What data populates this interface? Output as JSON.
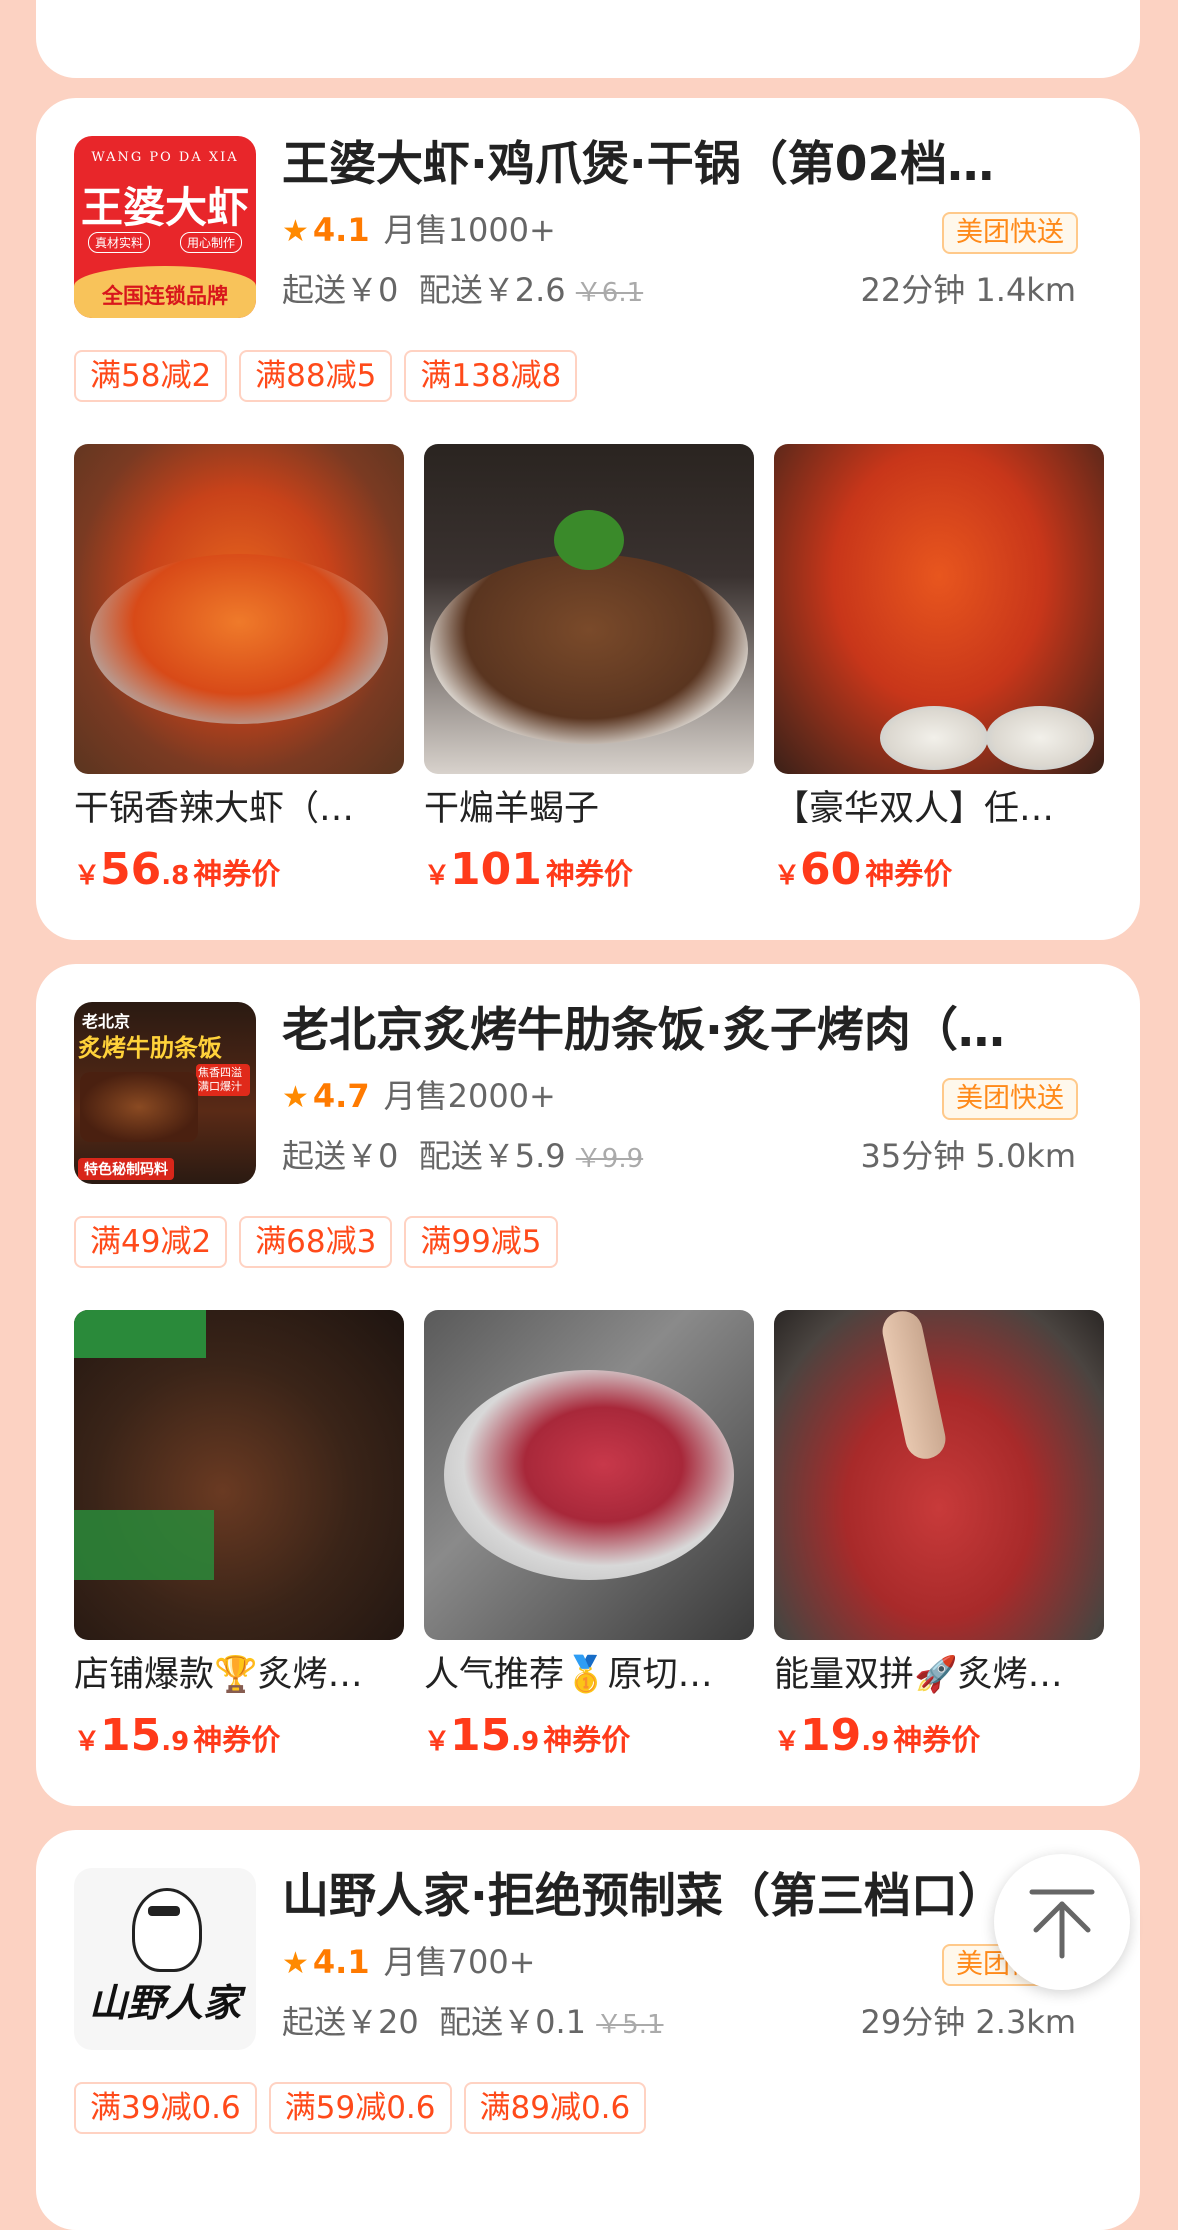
{
  "colors": {
    "accent": "#ff3a1a",
    "rating": "#ff7a00",
    "background": "#fcd2c2",
    "badge": "#ff8a1a"
  },
  "stores": [
    {
      "name": "王婆大虾·鸡爪煲·干锅（第02档…",
      "logo": {
        "top_text": "WANG PO DA XIA",
        "main_text": "王婆大虾",
        "sub_text": [
          "真材实料",
          "用心制作"
        ],
        "bottom_text": "全国连锁品牌"
      },
      "rating": "4.1",
      "monthly_sales": "月售1000+",
      "badge": "美团快送",
      "min_order": "起送￥0",
      "delivery_fee": "配送￥2.6",
      "original_fee": "￥6.1",
      "time": "22分钟",
      "distance": "1.4km",
      "coupons": [
        "满58减2",
        "满88减5",
        "满138减8"
      ],
      "dishes": [
        {
          "name": "干锅香辣大虾（…",
          "yen": "￥",
          "price_int": "56",
          "price_dec": ".8",
          "tag": "神券价"
        },
        {
          "name": "干煸羊蝎子",
          "yen": "￥",
          "price_int": "101",
          "price_dec": "",
          "tag": "神券价"
        },
        {
          "name": "【豪华双人】任…",
          "yen": "￥",
          "price_int": "60",
          "price_dec": "",
          "tag": "神券价"
        }
      ]
    },
    {
      "name": "老北京炙烤牛肋条饭·炙子烤肉（…",
      "logo": {
        "top_text": "老北京",
        "main_text": "炙烤牛肋条饭",
        "sub_text": [
          "焦香四溢",
          "满口爆汁"
        ],
        "bottom_text": "特色秘制码料"
      },
      "rating": "4.7",
      "monthly_sales": "月售2000+",
      "badge": "美团快送",
      "min_order": "起送￥0",
      "delivery_fee": "配送￥5.9",
      "original_fee": "￥9.9",
      "time": "35分钟",
      "distance": "5.0km",
      "coupons": [
        "满49减2",
        "满68减3",
        "满99减5"
      ],
      "dishes": [
        {
          "name": "店铺爆款🏆炙烤…",
          "yen": "￥",
          "price_int": "15",
          "price_dec": ".9",
          "tag": "神券价"
        },
        {
          "name": "人气推荐🥇原切…",
          "yen": "￥",
          "price_int": "15",
          "price_dec": ".9",
          "tag": "神券价"
        },
        {
          "name": "能量双拼🚀炙烤…",
          "yen": "￥",
          "price_int": "19",
          "price_dec": ".9",
          "tag": "神券价"
        }
      ]
    },
    {
      "name": "山野人家·拒绝预制菜（第三档口）",
      "logo": {
        "main_text": "山野人家"
      },
      "rating": "4.1",
      "monthly_sales": "月售700+",
      "badge": "美团快送",
      "min_order": "起送￥20",
      "delivery_fee": "配送￥0.1",
      "original_fee": "￥5.1",
      "time": "29分钟",
      "distance": "2.3km",
      "coupons": [
        "满39减0.6",
        "满59减0.6",
        "满89减0.6"
      ]
    }
  ],
  "back_to_top": "back-to-top-icon"
}
